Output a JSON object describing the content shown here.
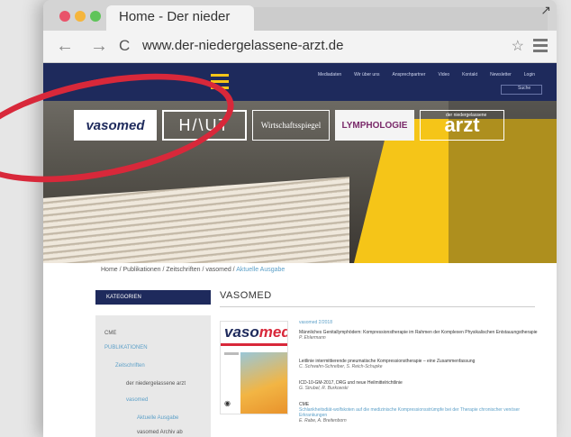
{
  "browser": {
    "tab_title": "Home - Der nieder",
    "url": "www.der-niedergelassene-arzt.de",
    "back": "←",
    "forward": "→",
    "reload": "C",
    "star": "☆",
    "expand": "↗"
  },
  "site": {
    "topnav": [
      "Mediadaten",
      "Wir über uns",
      "Ansprechpartner",
      "Video",
      "Kontakt",
      "Newsletter",
      "Login"
    ],
    "search_placeholder": "Suche",
    "logos": {
      "vasomed": "vasomed",
      "haut": "H/\\UT",
      "wirtschaft": "Wirtschaftsspiegel",
      "lymph": "LYMPHOLOGIE",
      "arzt_small": "der niedergelassene",
      "arzt": "arzt"
    },
    "breadcrumb": {
      "path": "Home / Publikationen / Zeitschriften / vasomed / ",
      "current": "Aktuelle Ausgabe"
    },
    "sidebar": {
      "header": "KATEGORIEN",
      "items": [
        {
          "label": "CME",
          "link": false
        },
        {
          "label": "PUBLIKATIONEN",
          "link": true
        },
        {
          "label": "Zeitschriften",
          "link": true
        },
        {
          "label": "der niedergelassene arzt",
          "link": false
        },
        {
          "label": "vasomed",
          "link": true
        },
        {
          "label": "Aktuelle Ausgabe",
          "link": true
        },
        {
          "label": "vasomed Archiv ab",
          "link": false
        }
      ]
    },
    "section_title": "VASOMED",
    "cover": {
      "title_a": "vaso",
      "title_b": "med"
    },
    "issue": "vasomed 2/2018",
    "articles": [
      {
        "title": "Männliches Genitallymphödem: Kompressionstherapie im Rahmen der Komplexen Physikalischen Entstauungstherapie",
        "authors": "P. Ehlermann"
      },
      {
        "title": "Leitlinie intermittierende pneumatische Kompressionstherapie – eine Zusammenfassung",
        "authors": "C. Schwahn-Schreiber, S. Reich-Schupke"
      },
      {
        "title": "ICD-10-GM-2017, DRG und neue Heilmittelrichtlinie",
        "authors": "G. Strubel, R. Burkowski"
      },
      {
        "title": "CME",
        "authors": ""
      }
    ],
    "cme_link": "Schlankheitsdiät-wolfskoten auf die medizinische Kompressionsstrümpfe bei der Therapie chronischer venöser Erkrankungen",
    "cme_authors": "E. Rabe, A. Breitenborn"
  }
}
